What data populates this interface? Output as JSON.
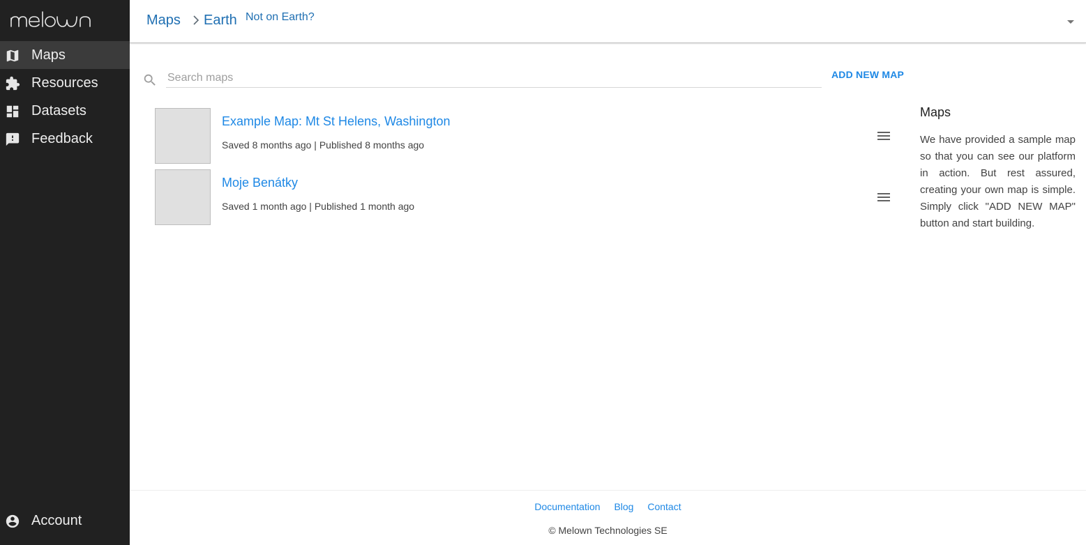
{
  "brand": {
    "logo_text": "melown"
  },
  "sidebar": {
    "items": [
      {
        "label": "Maps",
        "icon": "map-icon",
        "active": true
      },
      {
        "label": "Resources",
        "icon": "puzzle-icon"
      },
      {
        "label": "Datasets",
        "icon": "dashboard-icon"
      },
      {
        "label": "Feedback",
        "icon": "feedback-icon"
      }
    ],
    "account": {
      "label": "Account",
      "icon": "account-circle-icon"
    }
  },
  "header": {
    "breadcrumb": [
      "Maps",
      "Earth"
    ],
    "not_on_earth": "Not on Earth?"
  },
  "search": {
    "placeholder": "Search maps",
    "value": ""
  },
  "toolbar": {
    "add_label": "ADD NEW MAP"
  },
  "maps": [
    {
      "title": "Example Map: Mt St Helens, Washington",
      "meta": "Saved 8 months ago | Published 8 months ago"
    },
    {
      "title": "Moje Benátky",
      "meta": "Saved 1 month ago | Published 1 month ago"
    }
  ],
  "info": {
    "title": "Maps",
    "text": "We have provided a sample map so that you can see our platform in action. But rest assured, creating your own map is simple. Simply click \"ADD NEW MAP\" button and start building."
  },
  "footer": {
    "links": [
      "Documentation",
      "Blog",
      "Contact"
    ],
    "copyright": "© Melown Technologies SE"
  },
  "colors": {
    "sidebar_bg": "#212121",
    "sidebar_active": "#3b3b3b",
    "link": "#1e88e5",
    "breadcrumb": "#1f6fb2"
  }
}
